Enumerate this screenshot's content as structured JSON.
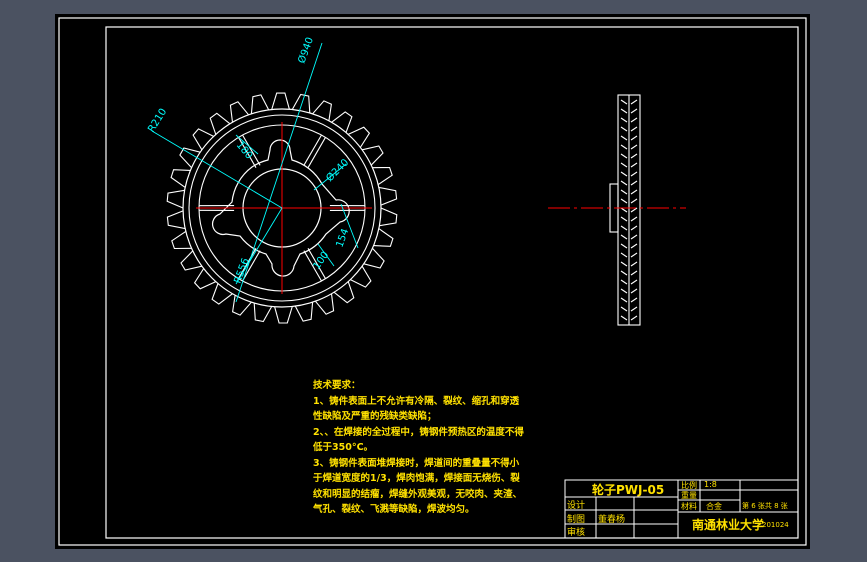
{
  "drawing": {
    "part_view": "front",
    "dimensions": {
      "d940": "Ø940",
      "r210": "R210",
      "d180": "180",
      "d240": "Ø240",
      "d154": "154",
      "d100": "100",
      "r556": "R556"
    },
    "tooth_count": 30
  },
  "notes": {
    "title": "技术要求：",
    "lines": [
      "1、铸件表面上不允许有冷隔、裂纹、缩孔和穿透",
      "性缺陷及严重的残缺类缺陷；",
      "2、、在焊接的全过程中，铸钢件预热区的温度不得",
      "低于350°C。",
      "3、铸钢件表面堆焊接时，焊道间的重叠量不得小",
      "于焊道宽度的1/3，焊肉饱满，焊接面无烧伤、裂",
      "纹和明显的结瘤，焊缝外观美观，无咬肉、夹渣、",
      "气孔、裂纹、飞溅等缺陷，焊波均匀。"
    ]
  },
  "title_block": {
    "part_name": "轮子PWJ-05",
    "scale_label": "比例",
    "scale_value": "1:8",
    "weight_label": "重量",
    "material_label": "材料",
    "material_value": "合金",
    "sheet_info": "第 6 张共 8 张",
    "design_label": "设计",
    "draw_label": "制图",
    "drafter_name": "董春杨",
    "check_label": "审核",
    "school": "南通林业大学",
    "drawing_code": "201024"
  },
  "colors": {
    "background": "#4b5261",
    "paper": "#000000",
    "line": "#ffffff",
    "dimension": "#00ffff",
    "centerline": "#ff0000",
    "note_text": "#ffe100",
    "titleblock_text": "#ffe100"
  }
}
